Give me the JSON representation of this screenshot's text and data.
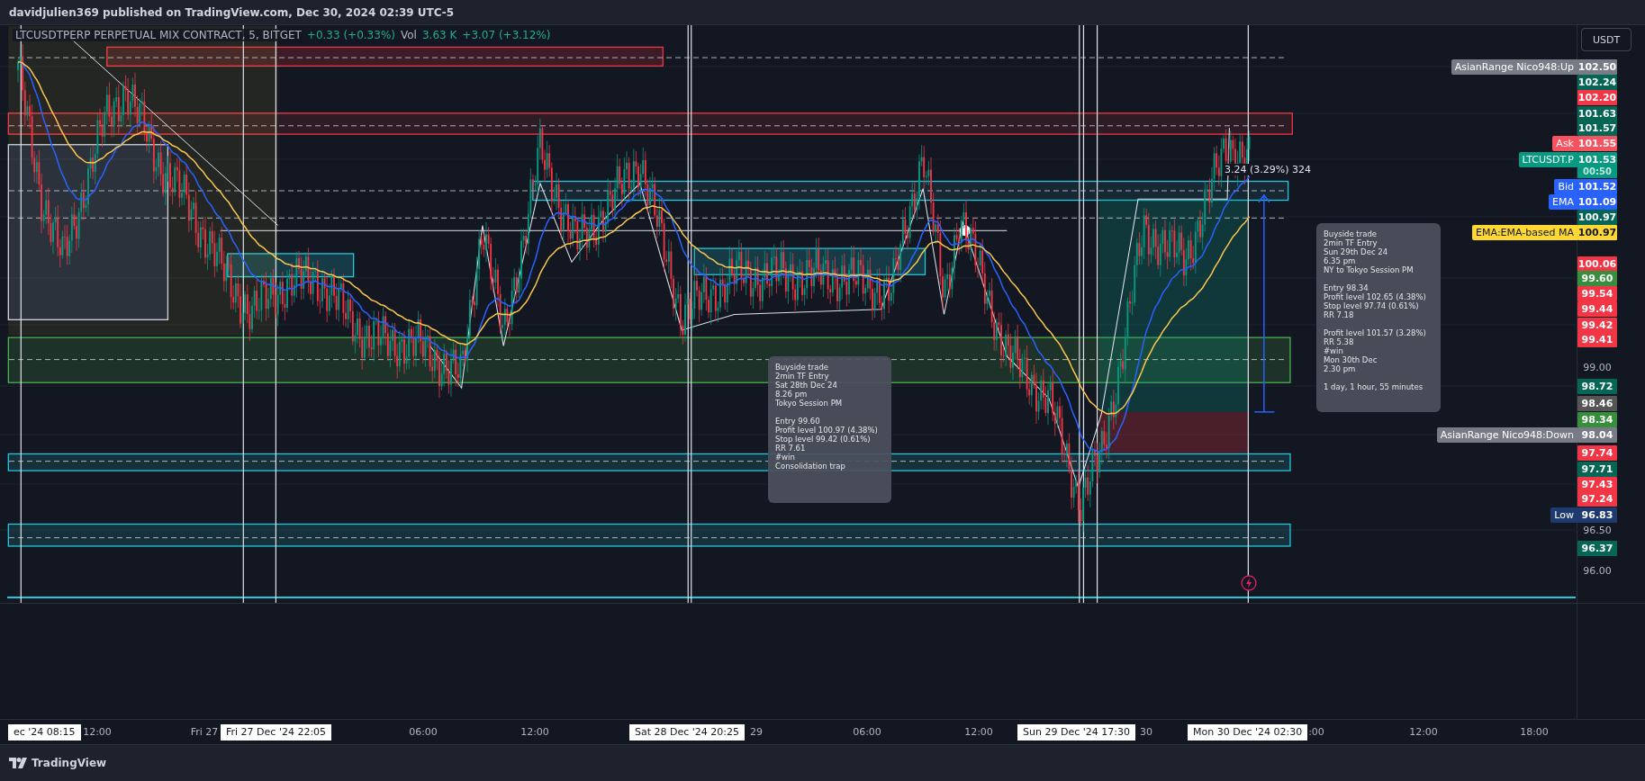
{
  "header": {
    "text": "davidjulien369 published on TradingView.com, Dec 30, 2024 02:39 UTC-5"
  },
  "legend": {
    "symbol": "LTCUSDTPERP PERPETUAL MIX CONTRACT, 5, BITGET",
    "change": "+0.33 (+0.33%)",
    "volume_label": "Vol",
    "volume": "3.63 K",
    "volume_change": "+3.07 (+3.12%)"
  },
  "currency_button": "USDT",
  "measure_label": "3.24 (3.29%) 324",
  "price_labels": [
    {
      "value": "102.50",
      "tag": "AsianRange Nico948:Up",
      "kind": "marker",
      "color": "#787b86"
    },
    {
      "value": "102.24",
      "kind": "marker",
      "color": "#056656"
    },
    {
      "value": "102.20",
      "kind": "marker",
      "color": "#f23645"
    },
    {
      "value": "101.63",
      "kind": "marker",
      "color": "#056656"
    },
    {
      "value": "101.57",
      "kind": "marker",
      "color": "#056656"
    },
    {
      "value": "101.55",
      "tag": "Ask",
      "kind": "marker",
      "color": "#f7525f"
    },
    {
      "value": "101.53",
      "tag": "LTCUSDT.P",
      "sub": "00:50",
      "kind": "marker",
      "color": "#089981"
    },
    {
      "value": "101.52",
      "tag": "Bid",
      "kind": "marker",
      "color": "#2962ff"
    },
    {
      "value": "101.09",
      "tag": "EMA",
      "kind": "marker",
      "color": "#2962ff"
    },
    {
      "value": "100.97",
      "kind": "marker",
      "color": "#056656"
    },
    {
      "value": "100.97",
      "tag": "EMA:EMA-based MA",
      "kind": "marker",
      "color": "#fdd835"
    },
    {
      "value": "100.06",
      "kind": "marker",
      "color": "#f23645"
    },
    {
      "value": "99.60",
      "kind": "marker",
      "color": "#388e3c"
    },
    {
      "value": "99.54",
      "kind": "marker",
      "color": "#f23645"
    },
    {
      "value": "99.44",
      "kind": "marker",
      "color": "#f23645"
    },
    {
      "value": "99.42",
      "kind": "marker",
      "color": "#f23645"
    },
    {
      "value": "99.41",
      "kind": "marker",
      "color": "#f23645"
    },
    {
      "value": "99.00",
      "kind": "tick"
    },
    {
      "value": "98.72",
      "kind": "marker",
      "color": "#056656"
    },
    {
      "value": "98.46",
      "kind": "marker",
      "color": "#555555"
    },
    {
      "value": "98.34",
      "kind": "marker",
      "color": "#388e3c"
    },
    {
      "value": "98.04",
      "tag": "AsianRange Nico948:Down",
      "kind": "marker",
      "color": "#787b86"
    },
    {
      "value": "97.74",
      "kind": "marker",
      "color": "#f23645"
    },
    {
      "value": "97.71",
      "kind": "marker",
      "color": "#056656"
    },
    {
      "value": "97.43",
      "kind": "marker",
      "color": "#f23645"
    },
    {
      "value": "97.24",
      "kind": "marker",
      "color": "#f23645"
    },
    {
      "value": "96.83",
      "tag": "Low",
      "kind": "marker",
      "color": "#1e3a6e"
    },
    {
      "value": "96.50",
      "kind": "tick"
    },
    {
      "value": "96.37",
      "kind": "marker",
      "color": "#056656"
    },
    {
      "value": "96.00",
      "kind": "tick"
    }
  ],
  "callouts": [
    {
      "paragraphs": [
        [
          "Buyside trade",
          "2min TF Entry",
          "Sat 28th Dec 24",
          "8.26 pm",
          "Tokyo Session PM"
        ],
        [
          "Entry 99.60",
          "Profit level 100.97 (4.38%)",
          "Stop level 99.42 (0.61%)",
          "RR 7.61",
          "#win",
          "Consolidation trap"
        ]
      ]
    },
    {
      "paragraphs": [
        [
          "Buyside trade",
          "2min TF Entry",
          "Sun 29th Dec 24",
          "6.35 pm",
          "NY to Tokyo Session PM"
        ],
        [
          "Entry 98.34",
          "Profit level 102.65 (4.38%)",
          "Stop level 97.74 (0.61%)",
          "RR 7.18"
        ],
        [
          "Profit level 101.57 (3.28%)",
          "RR 5.38",
          "#win",
          "Mon 30th Dec",
          "2.30 pm"
        ],
        [
          "1 day, 1 hour, 55 minutes"
        ]
      ]
    }
  ],
  "time_labels": [
    {
      "text": "ec '24  08:15",
      "kind": "marker"
    },
    {
      "text": "12:00",
      "kind": "tick"
    },
    {
      "text": "Fri 27",
      "kind": "tick"
    },
    {
      "text": "Fri 27 Dec '24  22:05",
      "kind": "marker"
    },
    {
      "text": "06:00",
      "kind": "tick"
    },
    {
      "text": "12:00",
      "kind": "tick"
    },
    {
      "text": "Sat 28 Dec '24  20:25",
      "kind": "marker"
    },
    {
      "text": "29",
      "kind": "tick"
    },
    {
      "text": "06:00",
      "kind": "tick"
    },
    {
      "text": "12:00",
      "kind": "tick"
    },
    {
      "text": "Sun 29 Dec '24  17:30",
      "kind": "marker"
    },
    {
      "text": "30",
      "kind": "tick"
    },
    {
      "text": "Mon 30 Dec '24  02:30",
      "kind": "marker"
    },
    {
      "text": ":00",
      "kind": "tick"
    },
    {
      "text": "12:00",
      "kind": "tick"
    },
    {
      "text": "18:00",
      "kind": "tick"
    }
  ],
  "footer": {
    "brand": "TradingView"
  }
}
